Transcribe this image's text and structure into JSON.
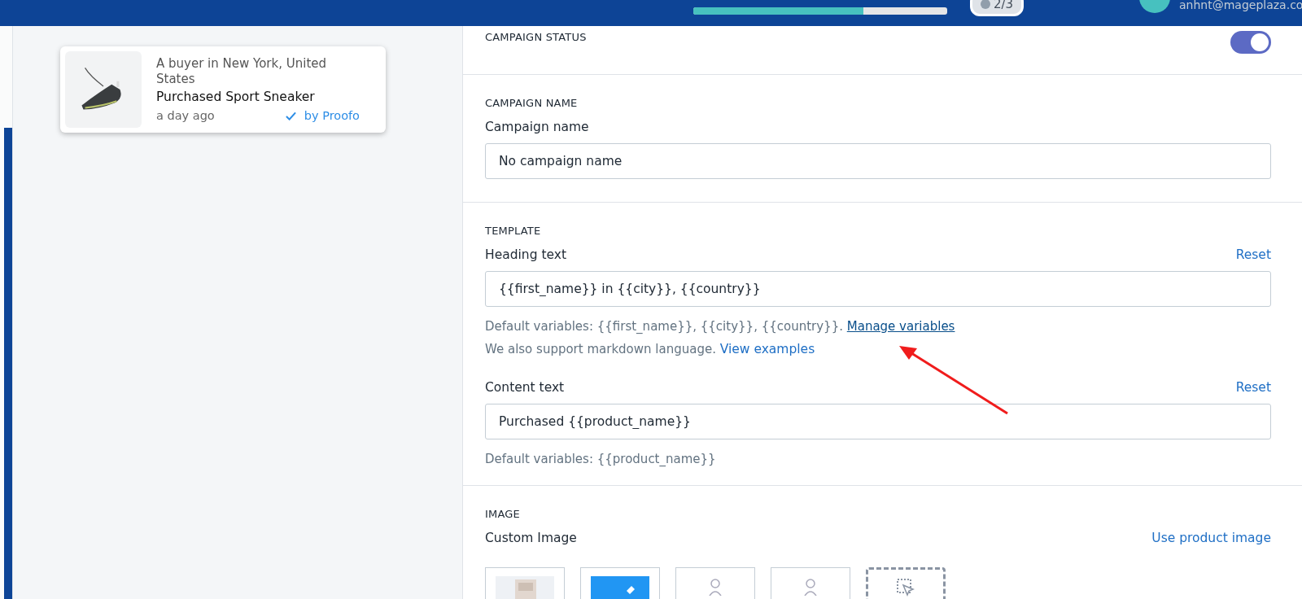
{
  "top_bar": {
    "progress": {
      "level": 0.67
    },
    "steps_badge": "2/3",
    "user_email": "anhnt@mageplaza.co"
  },
  "preview": {
    "location": "A buyer in New York, United States",
    "action": "Purchased Sport Sneaker",
    "time": "a day ago",
    "verified_by": "by Proofo"
  },
  "campaign_status": {
    "title": "CAMPAIGN STATUS",
    "on": true
  },
  "campaign_name": {
    "title": "CAMPAIGN NAME",
    "label": "Campaign name",
    "value": "No campaign name"
  },
  "template": {
    "title": "TEMPLATE",
    "heading": {
      "label": "Heading text",
      "reset": "Reset",
      "value": "{{first_name}} in {{city}}, {{country}}",
      "help": "Default variables: {{first_name}}, {{city}}, {{country}}.",
      "help_link": "Manage variables",
      "note": "We also support markdown language.",
      "note_link": "View examples"
    },
    "content": {
      "label": "Content text",
      "reset": "Reset",
      "value": "Purchased {{product_name}}",
      "help": "Default variables: {{product_name}}"
    }
  },
  "image": {
    "title": "IMAGE",
    "label": "Custom Image",
    "link": "Use product image",
    "thumbnails": [
      {
        "kind": "picture"
      },
      {
        "kind": "edit"
      },
      {
        "kind": "figure"
      },
      {
        "kind": "figure"
      },
      {
        "kind": "upload"
      }
    ]
  }
}
